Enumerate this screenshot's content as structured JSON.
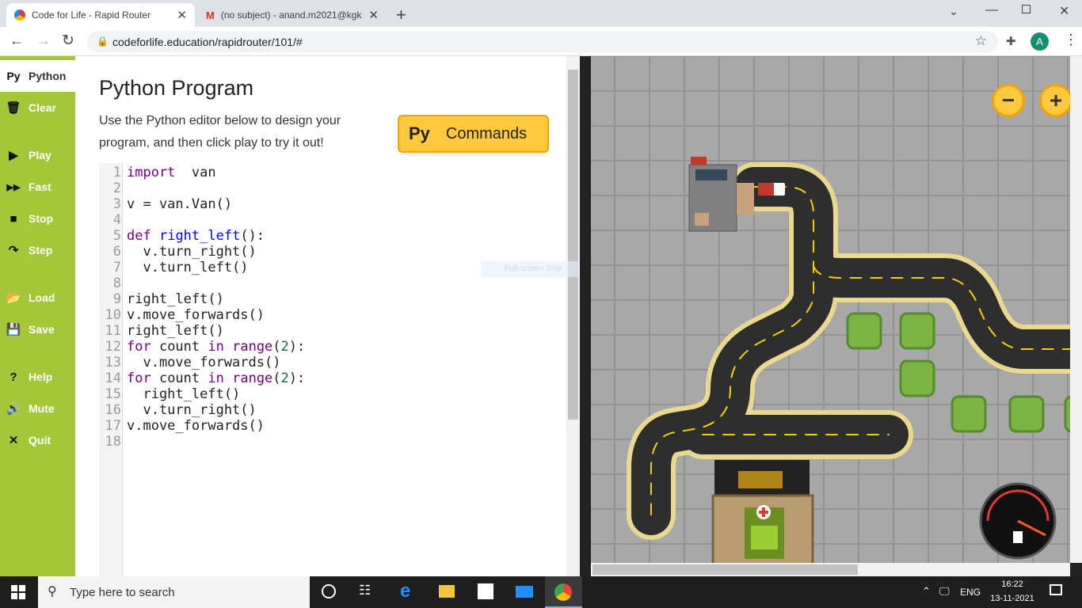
{
  "browser": {
    "tabs": [
      {
        "title": "Code for Life - Rapid Router",
        "favicon": "code-for-life-icon",
        "active": true
      },
      {
        "title": "(no subject) - anand.m2021@kgk",
        "favicon": "gmail-icon",
        "active": false
      }
    ],
    "new_tab": "+",
    "url": "codeforlife.education/rapidrouter/101/#",
    "profile_initial": "A",
    "profile_color": "#1a8c73"
  },
  "sidebar": {
    "color": "#a4c639",
    "items": [
      {
        "id": "python",
        "label": "Python",
        "icon": "Py"
      },
      {
        "id": "clear",
        "label": "Clear",
        "icon": "trash-icon"
      },
      {
        "id": "play",
        "label": "Play",
        "icon": "play-icon"
      },
      {
        "id": "fast",
        "label": "Fast",
        "icon": "fast-forward-icon"
      },
      {
        "id": "stop",
        "label": "Stop",
        "icon": "stop-icon"
      },
      {
        "id": "step",
        "label": "Step",
        "icon": "step-icon"
      },
      {
        "id": "load",
        "label": "Load",
        "icon": "folder-icon"
      },
      {
        "id": "save",
        "label": "Save",
        "icon": "floppy-icon"
      },
      {
        "id": "help",
        "label": "Help",
        "icon": "question-icon"
      },
      {
        "id": "mute",
        "label": "Mute",
        "icon": "speaker-icon"
      },
      {
        "id": "quit",
        "label": "Quit",
        "icon": "close-icon"
      }
    ]
  },
  "main": {
    "title": "Python Program",
    "intro_line1": "Use the Python editor below to design your",
    "intro_line2": "program, and then click play to try it out!",
    "commands_button": {
      "prefix": "Py",
      "label": "Commands"
    }
  },
  "code_lines": [
    {
      "n": "1",
      "parts": [
        [
          "kw",
          "import"
        ],
        [
          "",
          "  van"
        ]
      ]
    },
    {
      "n": "2",
      "parts": []
    },
    {
      "n": "3",
      "parts": [
        [
          "",
          "v = van.Van()"
        ]
      ]
    },
    {
      "n": "4",
      "parts": []
    },
    {
      "n": "5",
      "parts": [
        [
          "kw",
          "def"
        ],
        [
          "",
          " "
        ],
        [
          "fn",
          "right_left"
        ],
        [
          "",
          "():"
        ]
      ]
    },
    {
      "n": "6",
      "parts": [
        [
          "",
          "  v.turn_right()"
        ]
      ]
    },
    {
      "n": "7",
      "parts": [
        [
          "",
          "  v.turn_left()"
        ]
      ]
    },
    {
      "n": "8",
      "parts": []
    },
    {
      "n": "9",
      "parts": [
        [
          "",
          "right_left()"
        ]
      ]
    },
    {
      "n": "10",
      "parts": [
        [
          "",
          "v.move_forwards()"
        ]
      ]
    },
    {
      "n": "11",
      "parts": [
        [
          "",
          "right_left()"
        ]
      ]
    },
    {
      "n": "12",
      "parts": [
        [
          "kw",
          "for"
        ],
        [
          "",
          " count "
        ],
        [
          "kw",
          "in"
        ],
        [
          "",
          " "
        ],
        [
          "kw",
          "range"
        ],
        [
          "",
          "("
        ],
        [
          "num",
          "2"
        ],
        [
          "",
          "):"
        ]
      ]
    },
    {
      "n": "13",
      "parts": [
        [
          "",
          "  v.move_forwards()"
        ]
      ]
    },
    {
      "n": "14",
      "parts": [
        [
          "kw",
          "for"
        ],
        [
          "",
          " count "
        ],
        [
          "kw",
          "in"
        ],
        [
          "",
          " "
        ],
        [
          "kw",
          "range"
        ],
        [
          "",
          "("
        ],
        [
          "num",
          "2"
        ],
        [
          "",
          "):"
        ]
      ]
    },
    {
      "n": "15",
      "parts": [
        [
          "",
          "  right_left()"
        ]
      ]
    },
    {
      "n": "16",
      "parts": [
        [
          "",
          "  v.turn_right()"
        ]
      ]
    },
    {
      "n": "17",
      "parts": [
        [
          "",
          "v.move_forwards()"
        ]
      ]
    },
    {
      "n": "18",
      "parts": []
    }
  ],
  "game": {
    "zoom_out": "−",
    "zoom_in": "+",
    "overlay_text": "Full-screen Snip"
  },
  "taskbar": {
    "search_placeholder": "Type here to search",
    "language": "ENG",
    "time": "16:22",
    "date": "13-11-2021"
  }
}
